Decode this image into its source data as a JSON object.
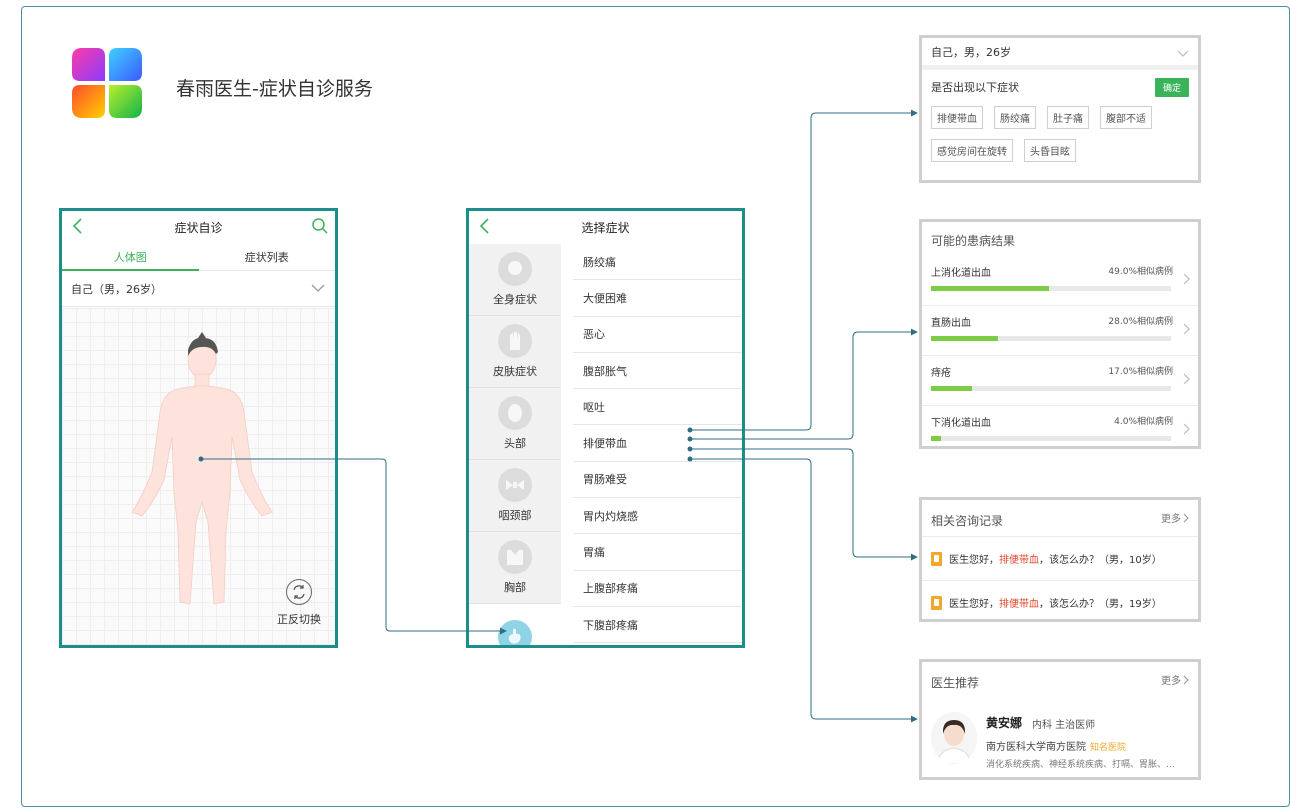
{
  "header": {
    "title": "春雨医生-症状自诊服务"
  },
  "colors": {
    "accent_green": "#3bb35b",
    "frame_teal": "#1b8d8a",
    "connector": "#2f6d86",
    "bar_fill": "#7ccc46",
    "highlight_red": "#e0472c",
    "badge_orange": "#f1a92d"
  },
  "screen1": {
    "title": "症状自诊",
    "tabs": [
      "人体图",
      "症状列表"
    ],
    "profile": "自己（男，26岁）",
    "flip_label": "正反切换"
  },
  "screen2": {
    "title": "选择症状",
    "categories": [
      "全身症状",
      "皮肤症状",
      "头部",
      "咽颈部",
      "胸部",
      ""
    ],
    "symptoms": [
      "肠绞痛",
      "大便困难",
      "恶心",
      "腹部胀气",
      "呕吐",
      "排便带血",
      "胃肠难受",
      "胃内灼烧感",
      "胃痛",
      "上腹部疼痛",
      "下腹部疼痛"
    ]
  },
  "card_symptoms": {
    "profile": "自己，男，26岁",
    "question": "是否出现以下症状",
    "confirm": "确定",
    "chips": [
      "排便带血",
      "肠绞痛",
      "肚子痛",
      "腹部不适",
      "感觉房间在旋转",
      "头昏目眩"
    ]
  },
  "card_results": {
    "title": "可能的患病结果",
    "items": [
      {
        "name": "上消化道出血",
        "pct_label": "49.0%相似病例",
        "value": 49.0
      },
      {
        "name": "直肠出血",
        "pct_label": "28.0%相似病例",
        "value": 28.0
      },
      {
        "name": "痔疮",
        "pct_label": "17.0%相似病例",
        "value": 17.0
      },
      {
        "name": "下消化道出血",
        "pct_label": "4.0%相似病例",
        "value": 4.0
      }
    ]
  },
  "card_consult": {
    "title": "相关咨询记录",
    "more": "更多",
    "items": [
      {
        "pre": "医生您好，",
        "hl": "排便带血",
        "post": "，该怎么办？（男，10岁）"
      },
      {
        "pre": "医生您好，",
        "hl": "排便带血",
        "post": "，该怎么办？（男，19岁）"
      }
    ]
  },
  "card_doctor": {
    "title": "医生推荐",
    "more": "更多",
    "name": "黄安娜",
    "dept_title": "内科  主治医师",
    "hospital": "南方医科大学南方医院",
    "tag": "知名医院",
    "specialty": "消化系统疾病、神经系统疾病、打嗝、胃胀、..."
  }
}
